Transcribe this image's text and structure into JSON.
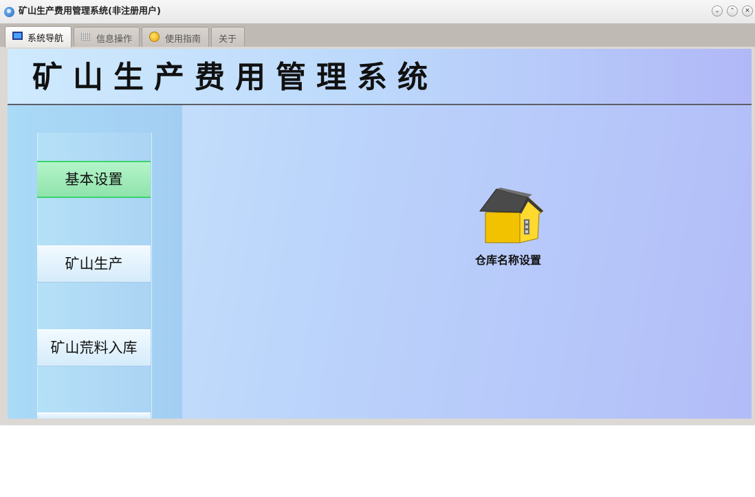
{
  "window": {
    "title": "矿山生产费用管理系统(非注册用户)",
    "controls": {
      "minimize": "⌄",
      "maximize": "⌃",
      "close": "✕"
    }
  },
  "tabs": [
    {
      "label": "系统导航",
      "icon": "monitor-icon",
      "active": true
    },
    {
      "label": "信息操作",
      "icon": "grid-icon",
      "active": false
    },
    {
      "label": "使用指南",
      "icon": "guide-icon",
      "active": false
    },
    {
      "label": "关于",
      "icon": null,
      "active": false
    }
  ],
  "banner": {
    "title": "矿山生产费用管理系统"
  },
  "sidebar": {
    "items": [
      {
        "label": "基本设置",
        "active": true
      },
      {
        "label": "矿山生产",
        "active": false
      },
      {
        "label": "矿山荒料入库",
        "active": false
      }
    ]
  },
  "desktop": {
    "items": [
      {
        "label": "仓库名称设置",
        "icon": "house-icon"
      }
    ]
  },
  "colors": {
    "active_nav": "#8fe3ac",
    "active_border": "#3ad36a",
    "banner_rule": "#5e5e66"
  }
}
